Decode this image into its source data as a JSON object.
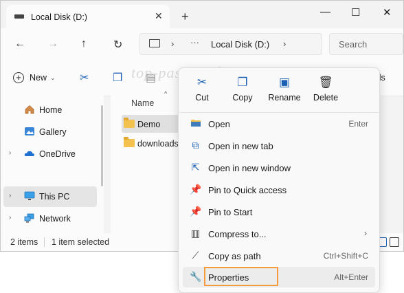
{
  "window": {
    "tab_title": "Local Disk (D:)",
    "tab_close": "✕",
    "new_tab": "+",
    "minimize": "—",
    "maximize": "☐",
    "close": "✕"
  },
  "nav": {
    "back": "←",
    "forward": "→",
    "up": "↑",
    "refresh": "↻",
    "breadcrumb_sep": "›",
    "overflow": "···",
    "path": "Local Disk (D:)",
    "search_placeholder": "Search"
  },
  "toolbar": {
    "new_label": "New",
    "new_caret": "⌄",
    "details_partial": "ils"
  },
  "watermark": "top-password.com",
  "sidebar": {
    "items": [
      {
        "label": "Home",
        "chevron": ""
      },
      {
        "label": "Gallery",
        "chevron": ""
      },
      {
        "label": "OneDrive",
        "chevron": "›"
      },
      {
        "label": "This PC",
        "chevron": "›",
        "selected": true
      },
      {
        "label": "Network",
        "chevron": "›"
      }
    ]
  },
  "files": {
    "column_header": "Name",
    "sort_caret": "^",
    "rows": [
      {
        "name": "Demo",
        "selected": true
      },
      {
        "name": "downloads",
        "selected": false
      }
    ]
  },
  "status": {
    "count": "2 items",
    "selection": "1 item selected"
  },
  "context_menu": {
    "top_actions": [
      {
        "label": "Cut",
        "icon": "scissors-icon"
      },
      {
        "label": "Copy",
        "icon": "copy-icon"
      },
      {
        "label": "Rename",
        "icon": "rename-icon"
      },
      {
        "label": "Delete",
        "icon": "trash-icon"
      }
    ],
    "items": [
      {
        "label": "Open",
        "shortcut": "Enter",
        "icon": "folder-open-icon"
      },
      {
        "label": "Open in new tab",
        "shortcut": "",
        "icon": "new-tab-icon"
      },
      {
        "label": "Open in new window",
        "shortcut": "",
        "icon": "new-window-icon"
      },
      {
        "label": "Pin to Quick access",
        "shortcut": "",
        "icon": "pin-icon"
      },
      {
        "label": "Pin to Start",
        "shortcut": "",
        "icon": "pin-icon"
      },
      {
        "label": "Compress to...",
        "shortcut": "",
        "submenu": "›",
        "icon": "zip-icon"
      },
      {
        "label": "Copy as path",
        "shortcut": "Ctrl+Shift+C",
        "icon": "path-icon"
      },
      {
        "label": "Properties",
        "shortcut": "Alt+Enter",
        "icon": "wrench-icon",
        "highlighted": true
      }
    ]
  },
  "colors": {
    "accent": "#1a5fb4",
    "highlight_box": "#f59b3a",
    "folder": "#f2c14e"
  }
}
